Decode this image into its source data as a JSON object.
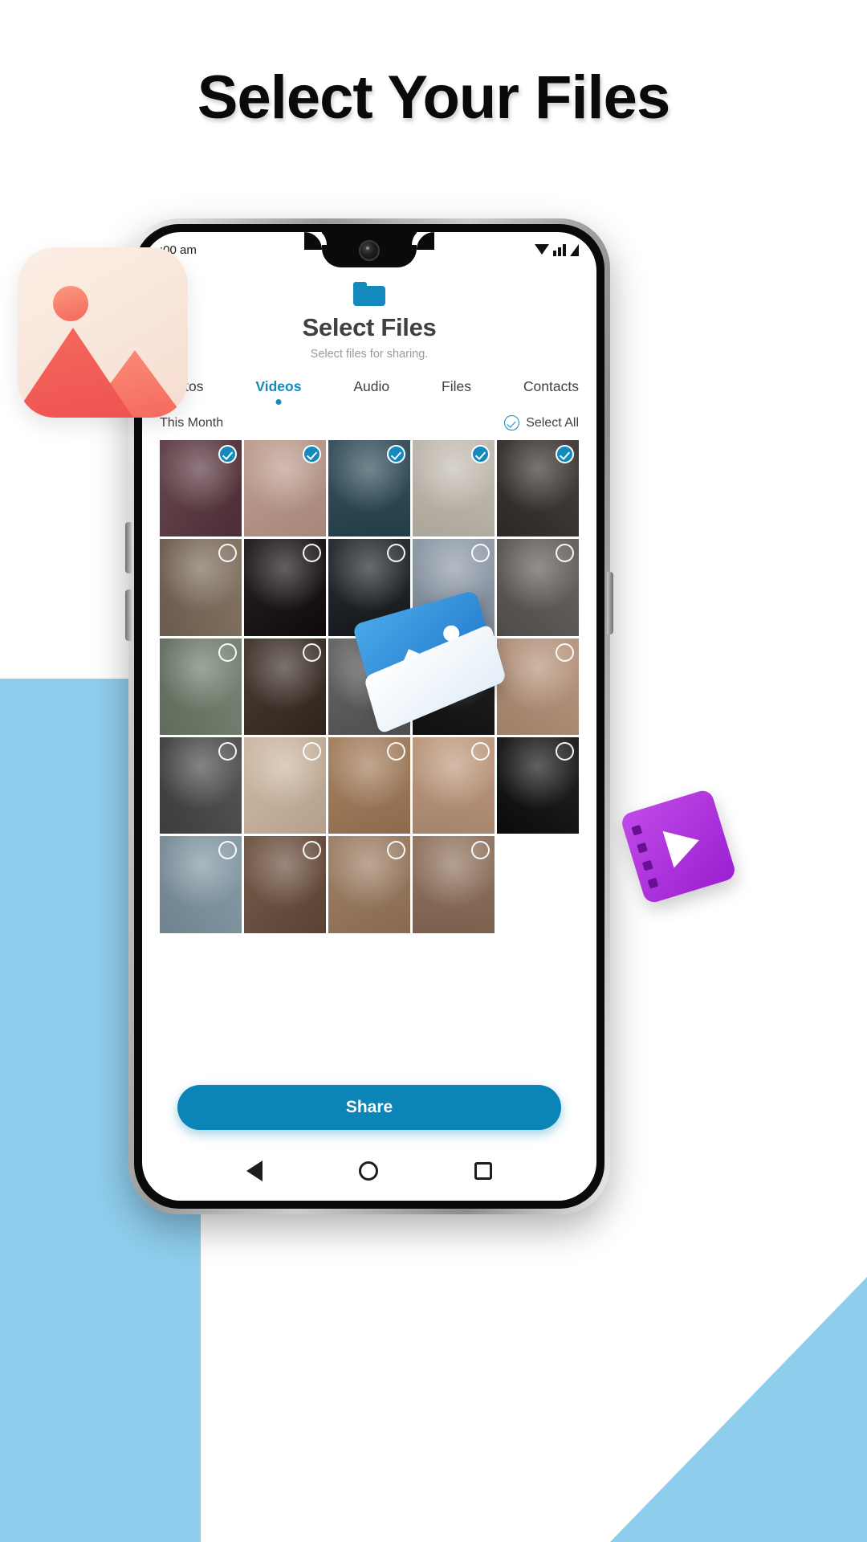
{
  "page": {
    "title": "Select Your Files",
    "background_color": "#ffffff",
    "accent_color": "#1389bd",
    "decor_color": "#8ecdec"
  },
  "status_bar": {
    "time": ":00 am",
    "icons": [
      "wifi-icon",
      "signal-icon",
      "battery-signal-icon"
    ]
  },
  "app": {
    "folder_icon": "folder-icon",
    "title": "Select Files",
    "subtitle": "Select files for sharing."
  },
  "tabs": [
    {
      "label": "Photos",
      "active": false
    },
    {
      "label": "Videos",
      "active": true
    },
    {
      "label": "Audio",
      "active": false
    },
    {
      "label": "Files",
      "active": false
    },
    {
      "label": "Contacts",
      "active": false
    }
  ],
  "section": {
    "label": "This Month",
    "select_all_label": "Select All",
    "select_all_icon": "check-circle-icon"
  },
  "grid": {
    "columns": 5,
    "items": [
      {
        "id": 1,
        "checked": true,
        "tone": "#6b4a52"
      },
      {
        "id": 2,
        "checked": true,
        "tone": "#c9a89a"
      },
      {
        "id": 3,
        "checked": true,
        "tone": "#3f5a66"
      },
      {
        "id": 4,
        "checked": true,
        "tone": "#cfc8bd"
      },
      {
        "id": 5,
        "checked": true,
        "tone": "#4a4440"
      },
      {
        "id": 6,
        "checked": false,
        "tone": "#8a7a6a"
      },
      {
        "id": 7,
        "checked": false,
        "tone": "#2a2426"
      },
      {
        "id": 8,
        "checked": false,
        "tone": "#2f3338"
      },
      {
        "id": 9,
        "checked": false,
        "tone": "#9aa6b4"
      },
      {
        "id": 10,
        "checked": false,
        "tone": "#6e6a66"
      },
      {
        "id": 11,
        "checked": false,
        "tone": "#7e8b7a"
      },
      {
        "id": 12,
        "checked": false,
        "tone": "#4d4038"
      },
      {
        "id": 13,
        "checked": false,
        "tone": "#6e6e6e"
      },
      {
        "id": 14,
        "checked": false,
        "tone": "#2b2b2b"
      },
      {
        "id": 15,
        "checked": false,
        "tone": "#c2a088"
      },
      {
        "id": 16,
        "checked": false,
        "tone": "#5a5a58"
      },
      {
        "id": 17,
        "checked": false,
        "tone": "#d8c3ae"
      },
      {
        "id": 18,
        "checked": false,
        "tone": "#b08a6a"
      },
      {
        "id": 19,
        "checked": false,
        "tone": "#c9a58a"
      },
      {
        "id": 20,
        "checked": false,
        "tone": "#262626"
      },
      {
        "id": 21,
        "checked": false,
        "tone": "#8fa4b0"
      },
      {
        "id": 22,
        "checked": false,
        "tone": "#7a5f4e"
      },
      {
        "id": 23,
        "checked": false,
        "tone": "#a98a70"
      },
      {
        "id": 24,
        "checked": false,
        "tone": "#9c7f6b"
      }
    ]
  },
  "share": {
    "label": "Share"
  },
  "nav_bar": {
    "back": "back-triangle-icon",
    "home": "home-circle-icon",
    "recents": "recents-square-icon"
  },
  "decorations": {
    "image_icon": "image-placeholder-icon",
    "folder_photo_icon": "photo-folder-icon",
    "film_icon": "film-strip-play-icon"
  }
}
